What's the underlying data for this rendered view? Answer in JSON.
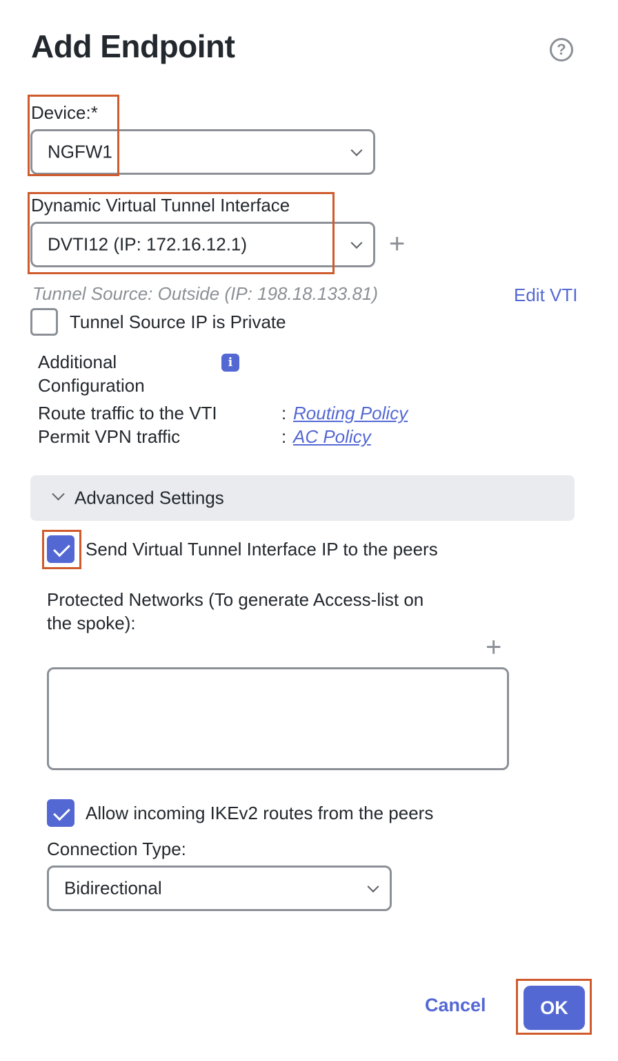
{
  "dialog": {
    "title": "Add Endpoint",
    "help_icon": "question-circle-icon"
  },
  "device": {
    "label": "Device:*",
    "value": "NGFW1"
  },
  "dvti": {
    "label": "Dynamic Virtual Tunnel Interface",
    "value": "DVTI12 (IP: 172.16.12.1)",
    "add_icon": "plus-icon"
  },
  "tunnel": {
    "source_text": "Tunnel Source: Outside (IP: 198.18.133.81)",
    "edit_link": "Edit VTI",
    "private_label": "Tunnel Source IP is Private",
    "private_checked": false
  },
  "additional": {
    "label_line1": "Additional",
    "label_line2": "Configuration",
    "info_icon": "info-icon",
    "route_label": "Route traffic to the VTI",
    "route_link": "Routing Policy",
    "permit_label": "Permit VPN traffic",
    "permit_link": "AC Policy",
    "separator": ":"
  },
  "advanced": {
    "label": "Advanced Settings",
    "expanded": true,
    "send_vti_label": "Send Virtual Tunnel Interface IP to the peers",
    "send_vti_checked": true,
    "protected_label_line1": "Protected Networks (To generate Access-list on",
    "protected_label_line2": "the spoke):",
    "protected_add_icon": "plus-icon",
    "allow_ikev2_label": "Allow incoming IKEv2 routes from the peers",
    "allow_ikev2_checked": true,
    "connection_type_label": "Connection Type:",
    "connection_type_value": "Bidirectional"
  },
  "footer": {
    "cancel_label": "Cancel",
    "ok_label": "OK"
  },
  "colors": {
    "accent": "#5468d4",
    "highlight": "#cf5a2c",
    "border": "#8b9096",
    "text": "#23282e"
  }
}
